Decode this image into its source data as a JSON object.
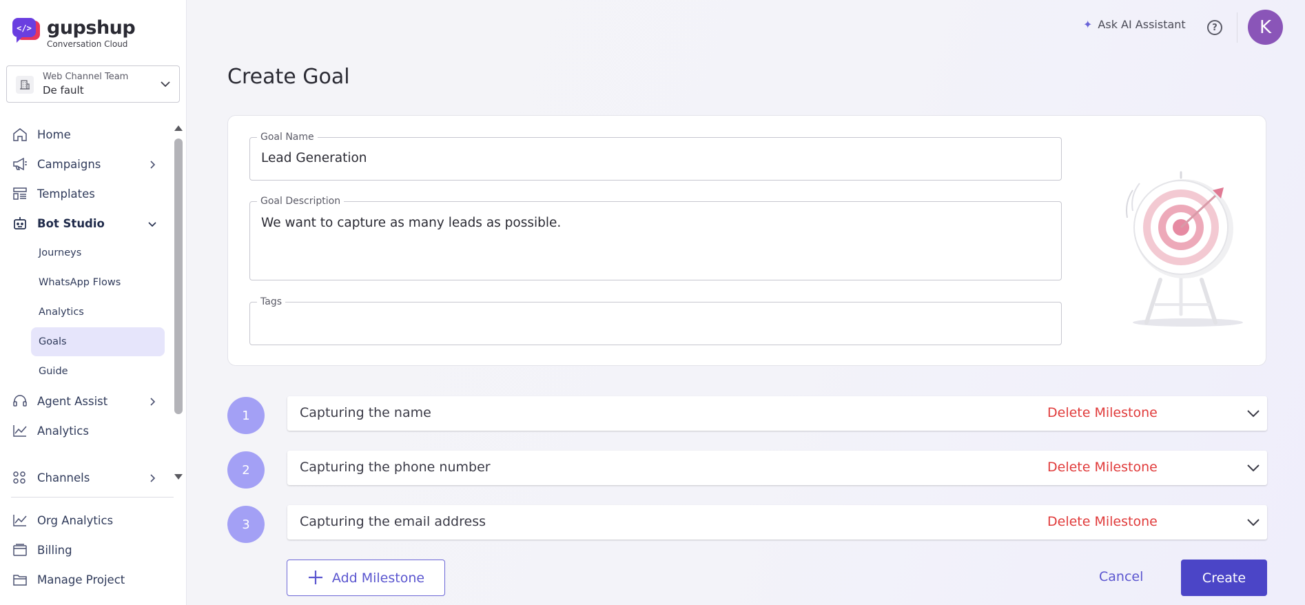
{
  "brand": {
    "name": "gupshup",
    "subtitle": "Conversation Cloud"
  },
  "team": {
    "label": "Web Channel Team",
    "value": "De fault"
  },
  "nav": {
    "home": "Home",
    "campaigns": "Campaigns",
    "templates": "Templates",
    "bot_studio": "Bot Studio",
    "bot_studio_sub": {
      "journeys": "Journeys",
      "whatsapp_flows": "WhatsApp Flows",
      "analytics": "Analytics",
      "goals": "Goals",
      "guide": "Guide"
    },
    "agent_assist": "Agent Assist",
    "analytics": "Analytics",
    "channels": "Channels",
    "org_analytics": "Org Analytics",
    "billing": "Billing",
    "manage_project": "Manage Project"
  },
  "header": {
    "ask_ai": "Ask AI Assistant",
    "help": "?",
    "avatar_initial": "K"
  },
  "page": {
    "title": "Create Goal"
  },
  "form": {
    "goal_name_label": "Goal Name",
    "goal_name_value": "Lead Generation",
    "goal_description_label": "Goal Description",
    "goal_description_value": "We want to capture as many leads as possible.",
    "tags_label": "Tags",
    "tags_value": ""
  },
  "milestones": [
    {
      "number": "1",
      "title": "Capturing the name",
      "delete_label": "Delete Milestone"
    },
    {
      "number": "2",
      "title": "Capturing the phone number",
      "delete_label": "Delete Milestone"
    },
    {
      "number": "3",
      "title": "Capturing the email address",
      "delete_label": "Delete Milestone"
    }
  ],
  "actions": {
    "add_milestone": "Add Milestone",
    "cancel": "Cancel",
    "create": "Create"
  },
  "colors": {
    "accent": "#4b45c7",
    "step": "#a3a0f5",
    "danger": "#e03a3a",
    "active_nav": "#e6e5fb",
    "avatar": "#8a55b8"
  }
}
